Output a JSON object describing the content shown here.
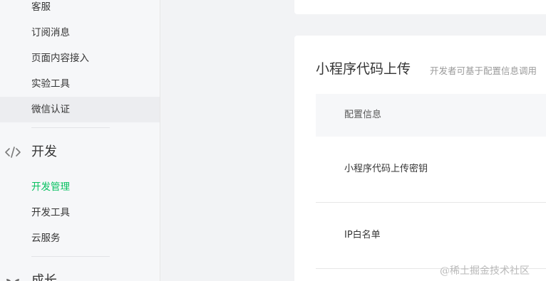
{
  "sidebar": {
    "items_top": [
      {
        "label": "客服"
      },
      {
        "label": "订阅消息"
      },
      {
        "label": "页面内容接入"
      },
      {
        "label": "实验工具"
      },
      {
        "label": "微信认证"
      }
    ],
    "section_dev": {
      "label": "开发",
      "icon": "code-icon"
    },
    "items_dev": [
      {
        "label": "开发管理"
      },
      {
        "label": "开发工具"
      },
      {
        "label": "云服务"
      }
    ],
    "section_growth": {
      "label": "成长",
      "icon": "leaf-icon"
    },
    "active_color": "#07c160"
  },
  "main": {
    "card": {
      "title": "小程序代码上传",
      "desc": "开发者可基于配置信息调用",
      "table_header": "配置信息",
      "rows": [
        {
          "label": "小程序代码上传密钥"
        },
        {
          "label": "IP白名单"
        }
      ]
    }
  },
  "watermark": "@稀土掘金技术社区"
}
